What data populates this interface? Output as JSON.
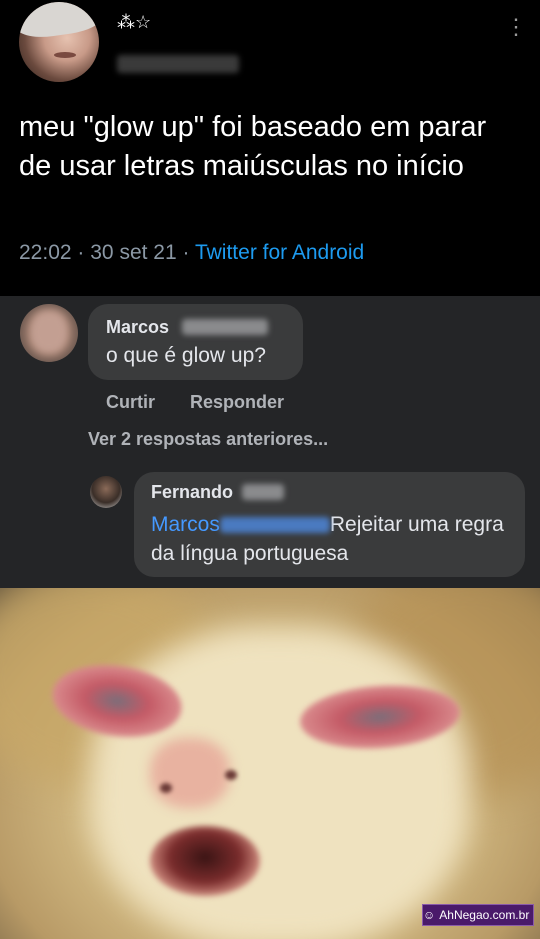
{
  "tweet": {
    "name_symbols": "⁂☆",
    "text": "meu \"glow up\" foi baseado em parar de usar letras maiúsculas no início",
    "time": "22:02",
    "date": "30 set 21",
    "separator": "·",
    "source": "Twitter for Android"
  },
  "comments": [
    {
      "author": "Marcos",
      "text": "o que é glow up?",
      "actions": [
        "Curtir",
        "Responder"
      ]
    }
  ],
  "view_more": "Ver 2 respostas anteriores...",
  "reply": {
    "author": "Fernando",
    "mention": "Marcos",
    "text": "Rejeitar uma regra da língua portuguesa"
  },
  "watermark": "AhNegao.com.br"
}
